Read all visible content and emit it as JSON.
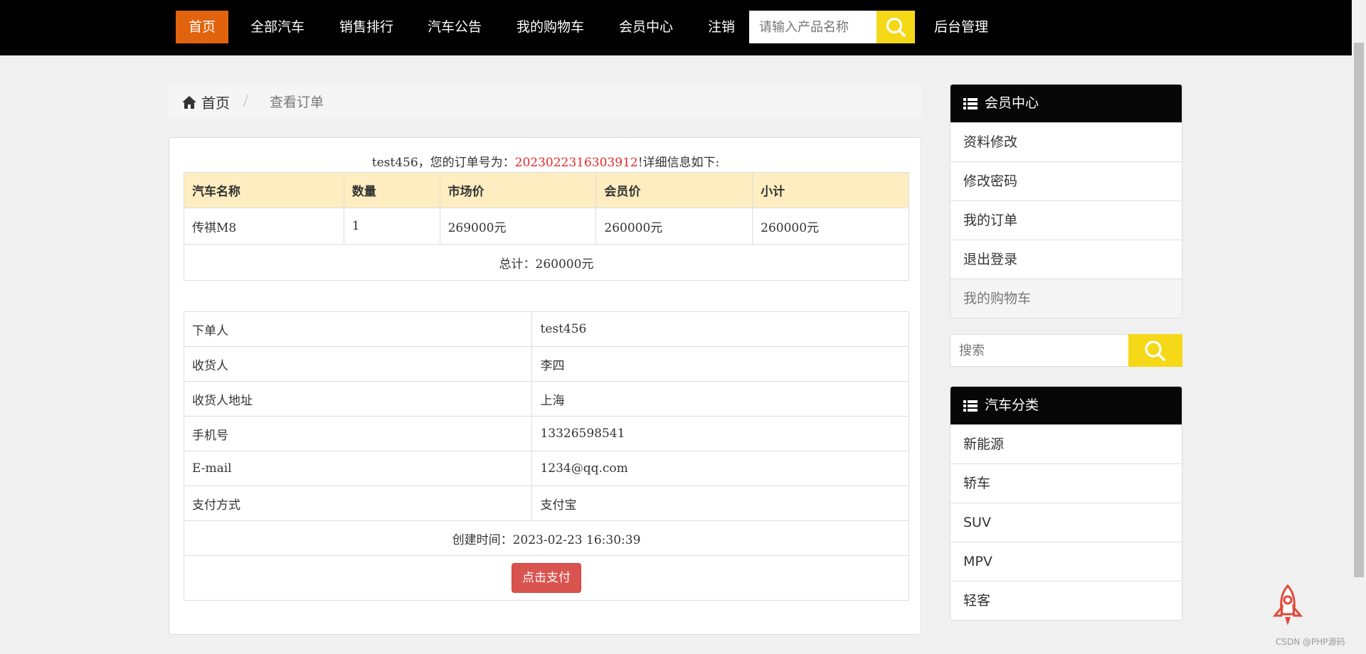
{
  "nav": {
    "items": [
      {
        "label": "首页",
        "active": true
      },
      {
        "label": "全部汽车"
      },
      {
        "label": "销售排行"
      },
      {
        "label": "汽车公告"
      },
      {
        "label": "我的购物车"
      },
      {
        "label": "会员中心"
      },
      {
        "label": "注销"
      }
    ],
    "search_placeholder": "请输入产品名称",
    "admin": "后台管理",
    "accent": "#e2630d",
    "search_color": "#f5d817"
  },
  "breadcrumb": {
    "home": "首页",
    "sep": "/",
    "current": "查看订单"
  },
  "order": {
    "user": "test456",
    "intro": "，您的订单号为：",
    "number": "2023022316303912",
    "outro": "!详细信息如下:",
    "columns": [
      "汽车名称",
      "数量",
      "市场价",
      "会员价",
      "小计"
    ],
    "items": [
      {
        "name": "传祺M8",
        "qty": "1",
        "market": "269000元",
        "member": "260000元",
        "subtotal": "260000元"
      }
    ],
    "total": "总计：260000元",
    "details": [
      {
        "label": "下单人",
        "value": "test456"
      },
      {
        "label": "收货人",
        "value": "李四"
      },
      {
        "label": "收货人地址",
        "value": "上海"
      },
      {
        "label": "手机号",
        "value": "13326598541"
      },
      {
        "label": "E-mail",
        "value": "1234@qq.com"
      },
      {
        "label": "支付方式",
        "value": "支付宝"
      }
    ],
    "created": "创建时间：2023-02-23 16:30:39",
    "pay_label": "点击支付"
  },
  "member_center": {
    "title": "会员中心",
    "items": [
      "资料修改",
      "修改密码",
      "我的订单",
      "退出登录"
    ],
    "cart": "我的购物车"
  },
  "side_search": {
    "placeholder": "搜索"
  },
  "categories": {
    "title": "汽车分类",
    "items": [
      "新能源",
      "轿车",
      "SUV",
      "MPV",
      "轻客"
    ]
  },
  "footer": "CSDN @PHP源码"
}
